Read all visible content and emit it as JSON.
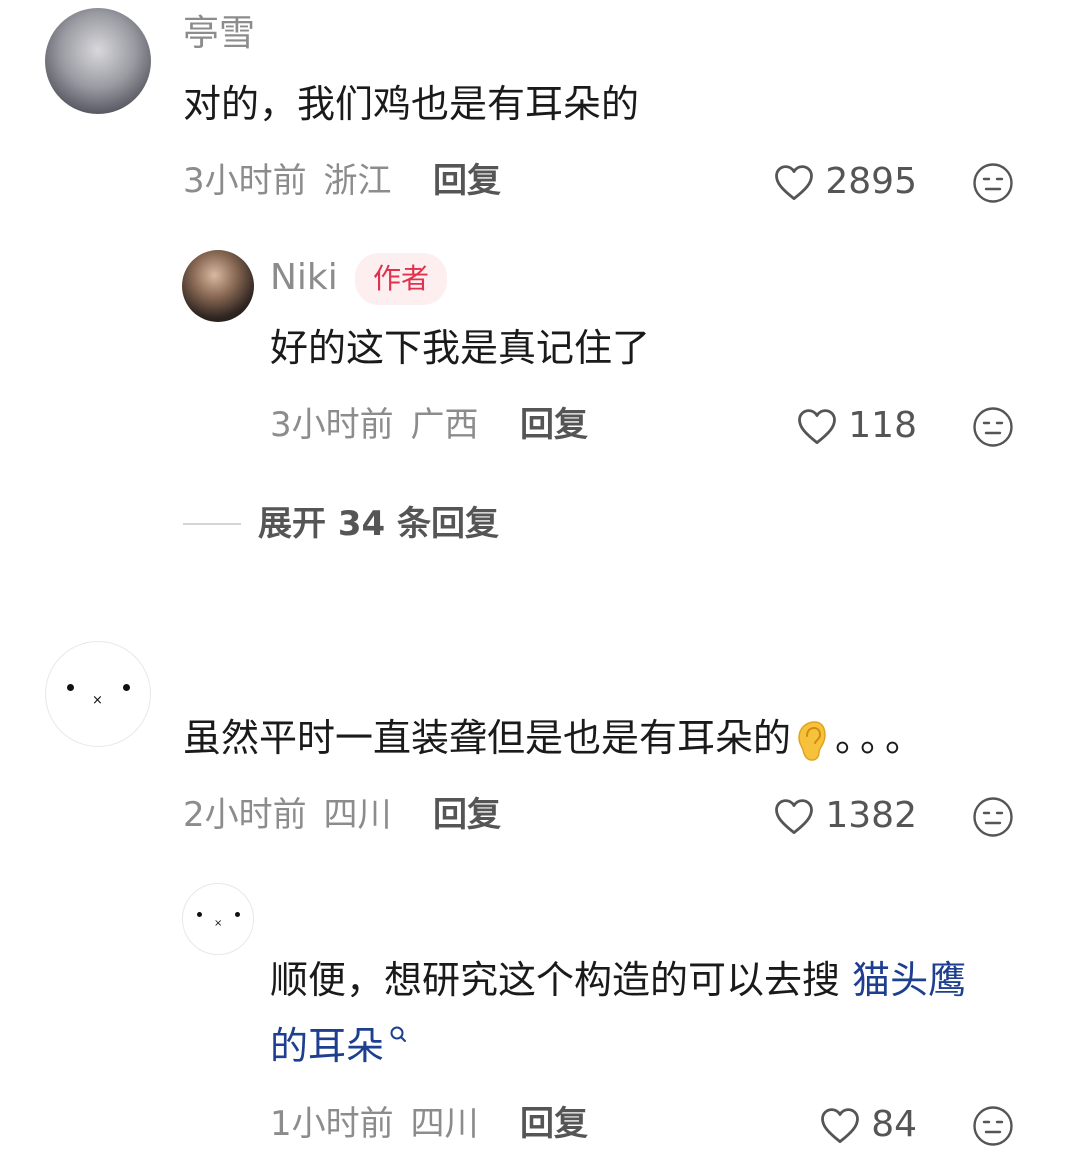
{
  "comments": [
    {
      "user": "亭雪",
      "text": "对的，我们鸡也是有耳朵的",
      "time": "3小时前",
      "location": "浙江",
      "reply_label": "回复",
      "likes": "2895",
      "replies": [
        {
          "user": "Niki",
          "badge": "作者",
          "text": "好的这下我是真记住了",
          "time": "3小时前",
          "location": "广西",
          "reply_label": "回复",
          "likes": "118"
        }
      ],
      "expand_label": "展开 34 条回复"
    },
    {
      "user": "",
      "text_main": "虽然平时一直装聋但是也是有耳朵的",
      "text_tail": "。。。",
      "time": "2小时前",
      "location": "四川",
      "reply_label": "回复",
      "likes": "1382",
      "replies": [
        {
          "text_line1_plain": "顺便，想研究这个构造的可以去搜 ",
          "text_line1_link": "猫头鹰",
          "text_line2_link": "的耳朵",
          "time": "1小时前",
          "location": "四川",
          "reply_label": "回复",
          "likes": "84"
        }
      ]
    }
  ],
  "colors": {
    "meta": "#8c8c8c",
    "badge_bg": "#fdeef0",
    "badge_text": "#e0324d",
    "link": "#1e3f8f"
  },
  "icons": [
    "heart-outline-icon",
    "dislike-face-icon",
    "ear-emoji",
    "search-icon"
  ]
}
